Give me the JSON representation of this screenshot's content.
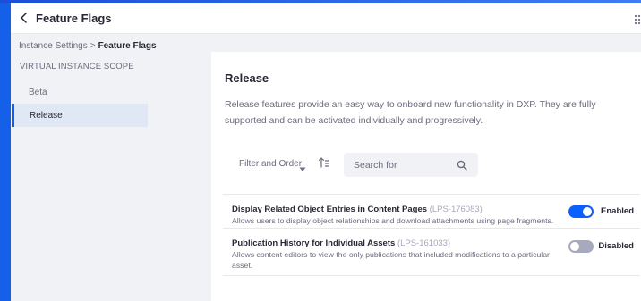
{
  "header": {
    "title": "Feature Flags",
    "back_icon": "chevron-left-icon",
    "apps_icon": "app-grid-icon"
  },
  "breadcrumb": {
    "parent": "Instance Settings",
    "separator": ">",
    "current": "Feature Flags"
  },
  "sidebar": {
    "scope_label": "VIRTUAL INSTANCE SCOPE",
    "items": [
      {
        "label": "Beta",
        "active": false
      },
      {
        "label": "Release",
        "active": true
      }
    ]
  },
  "main": {
    "title": "Release",
    "description": "Release features provide an easy way to onboard new functionality in DXP. They are fully supported and can be activated individually and progressively.",
    "toolbar": {
      "filter_label": "Filter and Order",
      "caret_icon": "caret-down-icon",
      "order_icon": "sort-order-icon",
      "search_placeholder": "Search for",
      "search_icon": "search-icon"
    },
    "flags": [
      {
        "name": "Display Related Object Entries in Content Pages",
        "code": "(LPS-176083)",
        "description": "Allows users to display object relationships and download attachments using page fragments.",
        "enabled": true,
        "status": "Enabled"
      },
      {
        "name": "Publication History for Individual Assets",
        "code": "(LPS-161033)",
        "description": "Allows content editors to view the only publications that included modifications to a particular asset.",
        "enabled": false,
        "status": "Disabled"
      }
    ]
  },
  "colors": {
    "accent": "#0b5fff",
    "toggle_off": "#a7a9bc",
    "active_item_bg": "#e0e8f5",
    "page_bg": "#f1f2f5"
  }
}
